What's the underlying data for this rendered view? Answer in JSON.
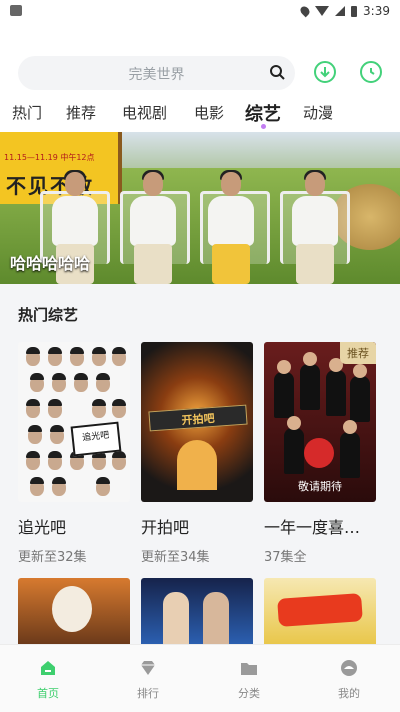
{
  "status_bar": {
    "time": "3:39"
  },
  "search": {
    "placeholder": "完美世界"
  },
  "tabs": [
    {
      "label": "热门"
    },
    {
      "label": "推荐"
    },
    {
      "label": "电视剧"
    },
    {
      "label": "电影"
    },
    {
      "label": "综艺",
      "active": true
    },
    {
      "label": "动漫"
    }
  ],
  "banner": {
    "caption": "哈哈哈哈哈",
    "sign_text": "不见不散",
    "sign_date": "11.15—11.19 中午12点"
  },
  "section": {
    "title": "热门综艺"
  },
  "cards": [
    {
      "title": "追光吧",
      "subtitle": "更新至32集",
      "poster_text": "追光吧"
    },
    {
      "title": "开拍吧",
      "subtitle": "更新至34集",
      "poster_text": "开拍吧"
    },
    {
      "title": "一年一度喜…",
      "subtitle": "37集全",
      "badge": "推荐",
      "poster_text": "敬请期待"
    }
  ],
  "bottom_nav": [
    {
      "label": "首页",
      "icon": "home-icon",
      "active": true
    },
    {
      "label": "排行",
      "icon": "diamond-icon"
    },
    {
      "label": "分类",
      "icon": "folder-icon"
    },
    {
      "label": "我的",
      "icon": "profile-icon"
    }
  ],
  "colors": {
    "accent": "#3ecf6e",
    "tab_dot": "#c27df2",
    "badge_bg": "#e7d5a6"
  }
}
